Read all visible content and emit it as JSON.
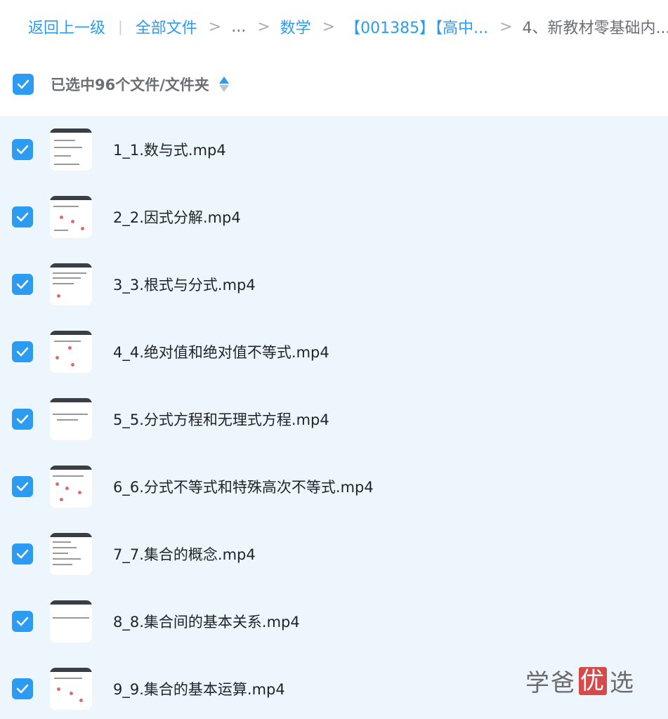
{
  "breadcrumb": {
    "back": "返回上一级",
    "all_files": "全部文件",
    "ellipsis": "...",
    "math": "数学",
    "code": "【001385】【高中...",
    "current": "4、新教材零基础内..."
  },
  "selection": {
    "text": "已选中96个文件/文件夹"
  },
  "files": [
    "1_1.数与式.mp4",
    "2_2.因式分解.mp4",
    "3_3.根式与分式.mp4",
    "4_4.绝对值和绝对值不等式.mp4",
    "5_5.分式方程和无理式方程.mp4",
    "6_6.分式不等式和特殊高次不等式.mp4",
    "7_7.集合的概念.mp4",
    "8_8.集合间的基本关系.mp4",
    "9_9.集合的基本运算.mp4"
  ],
  "watermark": {
    "part1": "学爸",
    "part2": "优",
    "part3": "选"
  },
  "colors": {
    "accent": "#2b9cf2",
    "list_bg": "#eef6fd"
  }
}
